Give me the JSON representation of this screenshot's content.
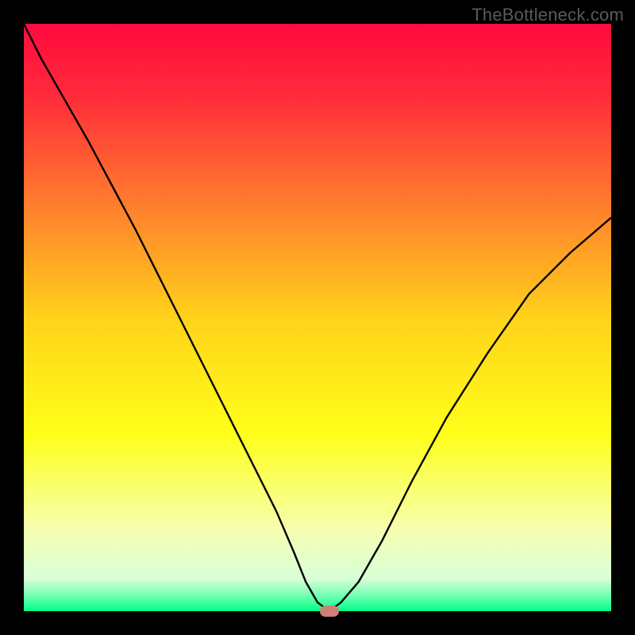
{
  "watermark": "TheBottleneck.com",
  "chart_data": {
    "type": "line",
    "title": "",
    "xlabel": "",
    "ylabel": "",
    "xlim": [
      0,
      100
    ],
    "ylim": [
      0,
      100
    ],
    "grid": false,
    "legend": false,
    "background": {
      "type": "vertical-gradient",
      "stops": [
        {
          "pos": 0.0,
          "color": "#ff0a3e"
        },
        {
          "pos": 0.12,
          "color": "#ff2a3a"
        },
        {
          "pos": 0.3,
          "color": "#ff7a2e"
        },
        {
          "pos": 0.5,
          "color": "#ffd21a"
        },
        {
          "pos": 0.7,
          "color": "#ffff1a"
        },
        {
          "pos": 0.86,
          "color": "#f5ffb0"
        },
        {
          "pos": 0.945,
          "color": "#d8ffd8"
        },
        {
          "pos": 0.975,
          "color": "#6dffb0"
        },
        {
          "pos": 1.0,
          "color": "#00ff88"
        }
      ]
    },
    "series": [
      {
        "name": "bottleneck-curve",
        "color": "#000000",
        "x": [
          0,
          3,
          7,
          11,
          15,
          19,
          23,
          27,
          31,
          35,
          39,
          43,
          46,
          48,
          50,
          52,
          54,
          57,
          61,
          66,
          72,
          79,
          86,
          93,
          100
        ],
        "y": [
          100,
          94,
          87,
          80,
          72.5,
          65,
          57,
          49,
          41,
          33,
          25,
          17,
          10,
          5,
          1.5,
          0,
          1.5,
          5,
          12,
          22,
          33,
          44,
          54,
          61,
          67
        ]
      }
    ],
    "marker": {
      "x": 52,
      "y": 0,
      "color": "#ce8277"
    }
  }
}
